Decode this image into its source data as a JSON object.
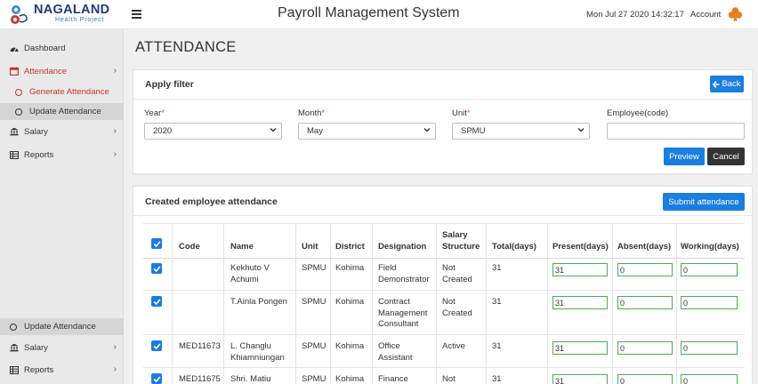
{
  "header": {
    "logo_line1": "NAGALAND",
    "logo_line2": "Health Project",
    "title": "Payroll Management System",
    "datetime": "Mon Jul 27 2020 14:32:17",
    "account_label": "Account"
  },
  "sidebar": {
    "dashboard": "Dashboard",
    "attendance": "Attendance",
    "generate_attendance": "Generate Attendance",
    "update_attendance": "Update Attendance",
    "salary": "Salary",
    "reports": "Reports",
    "update_attendance_2": "Update Attendance",
    "salary_2": "Salary",
    "reports_2": "Reports"
  },
  "page_title": "ATTENDANCE",
  "filter": {
    "title": "Apply filter",
    "back_label": "Back",
    "year_label": "Year",
    "year_value": "2020",
    "month_label": "Month",
    "month_value": "May",
    "unit_label": "Unit",
    "unit_value": "SPMU",
    "employee_label": "Employee(code)",
    "employee_value": "",
    "preview_label": "Preview",
    "cancel_label": "Cancel",
    "required_mark": "*"
  },
  "attendance": {
    "title": "Created employee attendance",
    "submit_label": "Submit attendance",
    "columns": {
      "code": "Code",
      "name": "Name",
      "unit": "Unit",
      "district": "District",
      "designation": "Designation",
      "salary_structure_1": "Salary",
      "salary_structure_2": "Structure",
      "total_days": "Total(days)",
      "present_days": "Present(days)",
      "absent_days": "Absent(days)",
      "working_days": "Working(days)"
    },
    "rows": [
      {
        "code": "",
        "name": [
          "Kekhuto V",
          "Achumi"
        ],
        "unit": "SPMU",
        "district": "Kohima",
        "designation": [
          "Field",
          "Demonstrator"
        ],
        "salary_structure": [
          "Not",
          "Created"
        ],
        "total": "31",
        "present": "31",
        "absent": "0",
        "working": "0"
      },
      {
        "code": "",
        "name": [
          "T.Ainla Pongen"
        ],
        "unit": "SPMU",
        "district": "Kohima",
        "designation": [
          "Contract",
          "Management",
          "Consultant"
        ],
        "salary_structure": [
          "Not",
          "Created"
        ],
        "total": "31",
        "present": "31",
        "absent": "0",
        "working": "0"
      },
      {
        "code": "MED11673",
        "name": [
          "L. Changlu",
          "Khiamniungan"
        ],
        "unit": "SPMU",
        "district": "Kohima",
        "designation": [
          "Office",
          "Assistant"
        ],
        "salary_structure": [
          "Active"
        ],
        "total": "31",
        "present": "31",
        "absent": "0",
        "working": "0"
      },
      {
        "code": "MED11675",
        "name": [
          "Shri. Matiu"
        ],
        "unit": "SPMU",
        "district": "Kohima",
        "designation": [
          "Finance"
        ],
        "salary_structure": [
          "Not"
        ],
        "total": "31",
        "present": "31",
        "absent": "0",
        "working": "0"
      }
    ]
  },
  "colors": {
    "accent": "#1a7de0",
    "active_red": "#c0392b",
    "input_green": "#4cae4c"
  }
}
